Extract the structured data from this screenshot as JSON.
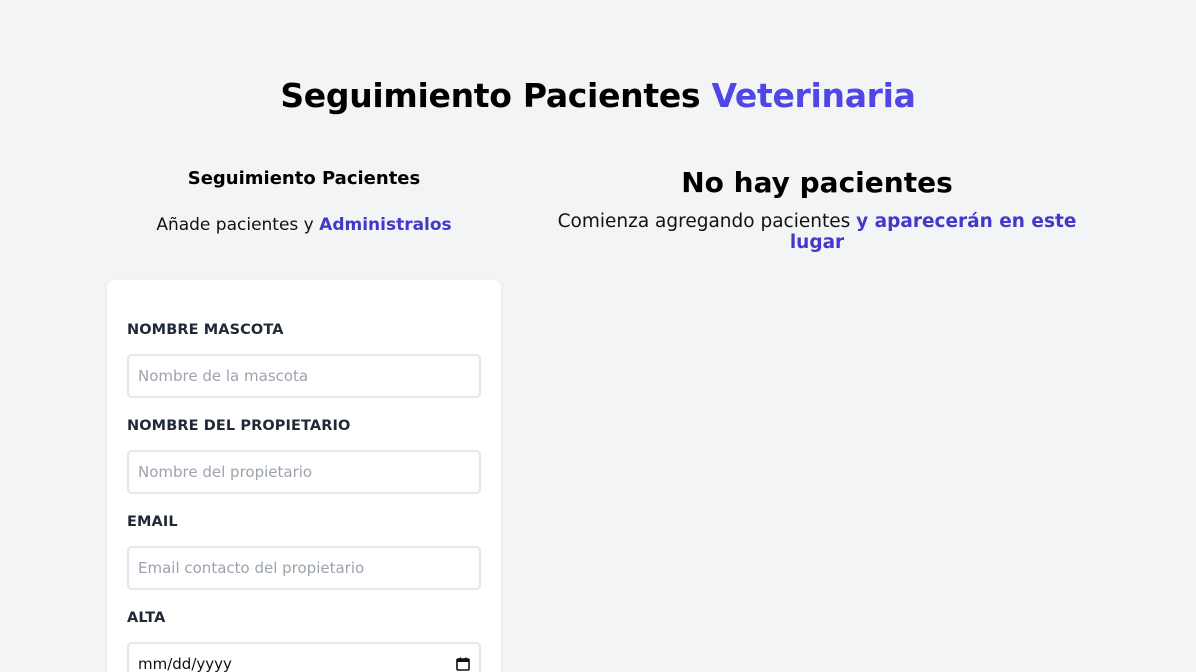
{
  "header": {
    "title_main": "Seguimiento Pacientes",
    "title_accent": "Veterinaria"
  },
  "form_section": {
    "heading": "Seguimiento Pacientes",
    "subtitle_prefix": "Añade pacientes y",
    "subtitle_accent": "Administralos"
  },
  "list_section": {
    "heading": "No hay pacientes",
    "subtitle_prefix": "Comienza agregando pacientes",
    "subtitle_accent": "y aparecerán en este lugar"
  },
  "form": {
    "fields": [
      {
        "label": "NOMBRE MASCOTA",
        "placeholder": "Nombre de la mascota"
      },
      {
        "label": "NOMBRE DEL PROPIETARIO",
        "placeholder": "Nombre del propietario"
      },
      {
        "label": "EMAIL",
        "placeholder": "Email contacto del propietario"
      },
      {
        "label": "ALTA",
        "value": "mm/dd/yyyy",
        "icon": "calendar-icon"
      }
    ]
  },
  "colors": {
    "accent": "#4f46e5",
    "background": "#f3f4f6",
    "card": "#ffffff"
  }
}
